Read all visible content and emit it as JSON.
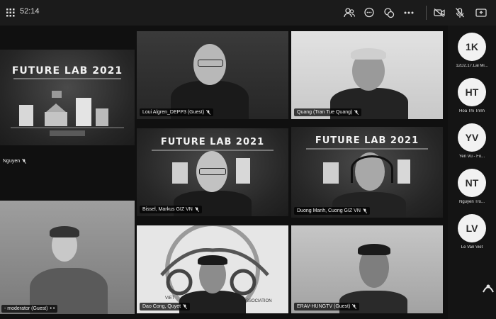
{
  "header": {
    "timer": "52:14"
  },
  "slides": {
    "title": "FUTURE LAB 2021"
  },
  "tiles": {
    "left_top_name": "Nguyen",
    "left_bottom_name": "- moderator (Guest)",
    "loui": "Loui Algren_DEPP3 (Guest)",
    "quang": "Quang (Tran Tue Quang)",
    "bissel": "Bissel, Markus GIZ VN",
    "duong": "Duong Manh, Cuong GIZ VN",
    "dao": "Dao Cong, Quyet",
    "erav": "ERAV-HUNGTV (Guest)",
    "dao_logo_text": "ASSOCIATION",
    "dao_logo_left": "VIET"
  },
  "sidebar": {
    "participants": [
      {
        "initials": "1K",
        "name": "12D2.17.Lai Mi..."
      },
      {
        "initials": "HT",
        "name": "Hoa Thi Trinh"
      },
      {
        "initials": "YV",
        "name": "Yen Vu - Fo..."
      },
      {
        "initials": "NT",
        "name": "Nguyen Tro..."
      },
      {
        "initials": "LV",
        "name": "Le Van Viet"
      }
    ]
  },
  "icons": [
    "grid-icon",
    "participants-icon",
    "chat-icon",
    "reactions-icon",
    "more-icon",
    "camera-off-icon",
    "mic-off-icon",
    "share-icon"
  ]
}
